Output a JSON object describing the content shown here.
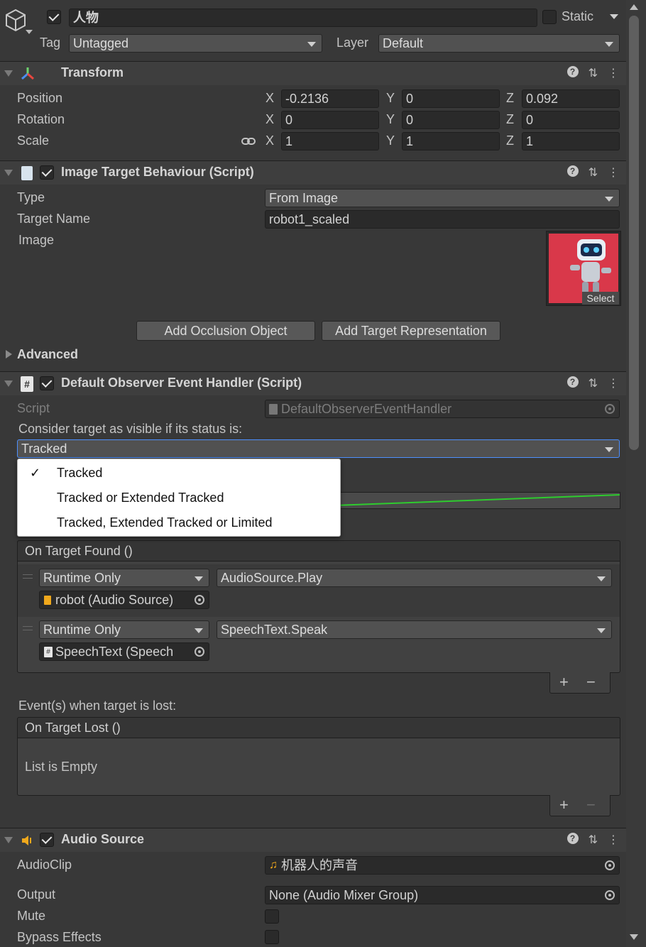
{
  "gameobject": {
    "name": "人物",
    "active": true,
    "static_label": "Static",
    "tag_label": "Tag",
    "tag_value": "Untagged",
    "layer_label": "Layer",
    "layer_value": "Default"
  },
  "transform": {
    "title": "Transform",
    "position_label": "Position",
    "rotation_label": "Rotation",
    "scale_label": "Scale",
    "x": "X",
    "y": "Y",
    "z": "Z",
    "position": {
      "x": "-0.2136",
      "y": "0",
      "z": "0.092"
    },
    "rotation": {
      "x": "0",
      "y": "0",
      "z": "0"
    },
    "scale": {
      "x": "1",
      "y": "1",
      "z": "1"
    }
  },
  "image_target": {
    "title": "Image Target Behaviour (Script)",
    "type_label": "Type",
    "type_value": "From Image",
    "target_name_label": "Target Name",
    "target_name_value": "robot1_scaled",
    "image_label": "Image",
    "select_label": "Select",
    "add_occlusion": "Add Occlusion Object",
    "add_representation": "Add Target Representation",
    "advanced_label": "Advanced"
  },
  "observer": {
    "title": "Default Observer Event Handler (Script)",
    "script_label": "Script",
    "script_value": "DefaultObserverEventHandler",
    "consider_label": "Consider target as visible if its status is:",
    "status_value": "Tracked",
    "status_options": [
      "Tracked",
      "Tracked or Extended Tracked",
      "Tracked, Extended Tracked or Limited"
    ],
    "found_header": "On Target Found ()",
    "found_events": [
      {
        "mode": "Runtime Only",
        "function": "AudioSource.Play",
        "object": "robot (Audio Source)"
      },
      {
        "mode": "Runtime Only",
        "function": "SpeechText.Speak",
        "object": "SpeechText (Speech"
      }
    ],
    "lost_label": "Event(s) when target is lost:",
    "lost_header": "On Target Lost ()",
    "lost_empty": "List is Empty",
    "plus": "+",
    "minus": "−"
  },
  "audio_source": {
    "title": "Audio Source",
    "clip_label": "AudioClip",
    "clip_value": "机器人的声音",
    "output_label": "Output",
    "output_value": "None (Audio Mixer Group)",
    "mute_label": "Mute",
    "bypass_label": "Bypass Effects"
  },
  "colors": {
    "background": "#383838",
    "header": "#3e3e3e",
    "field": "#2a2a2a",
    "focus": "#4d90fe",
    "curve_green": "#2ecc2e",
    "image_red": "#d9384a"
  }
}
